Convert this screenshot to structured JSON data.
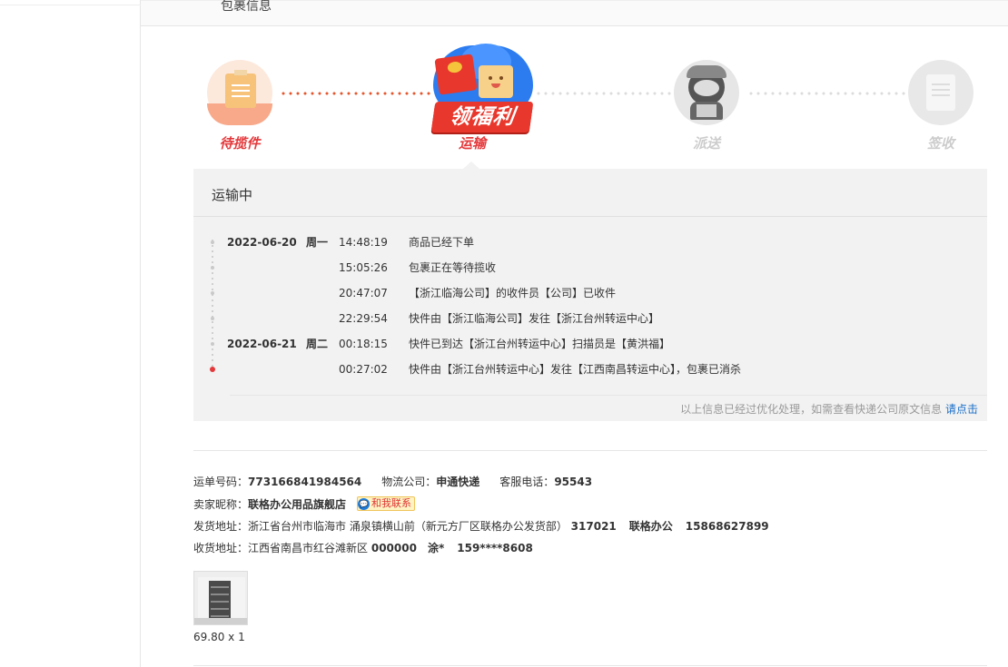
{
  "header": {
    "title": "包裹信息"
  },
  "steps": [
    {
      "label": "待揽件",
      "color": "#e4393c",
      "icon": "package-paper-icon"
    },
    {
      "label": "领福利",
      "color": "#ffffff",
      "icon": "red-packet-promo-icon"
    },
    {
      "label": "运输",
      "color": "#e4393c",
      "icon": ""
    },
    {
      "label": "派送",
      "color": "#cccccc",
      "icon": "courier-icon"
    },
    {
      "label": "签收",
      "color": "#cccccc",
      "icon": "receipt-icon"
    }
  ],
  "tracking": {
    "status": "运输中",
    "events": [
      {
        "date": "2022-06-20",
        "weekday": "周一",
        "time": "14:48:19",
        "desc": "商品已经下单"
      },
      {
        "date": "",
        "weekday": "",
        "time": "15:05:26",
        "desc": "包裹正在等待揽收"
      },
      {
        "date": "",
        "weekday": "",
        "time": "20:47:07",
        "desc": "【浙江临海公司】的收件员【公司】已收件"
      },
      {
        "date": "",
        "weekday": "",
        "time": "22:29:54",
        "desc": "快件由【浙江临海公司】发往【浙江台州转运中心】"
      },
      {
        "date": "2022-06-21",
        "weekday": "周二",
        "time": "00:18:15",
        "desc": "快件已到达【浙江台州转运中心】扫描员是【黄洪福】"
      },
      {
        "date": "",
        "weekday": "",
        "time": "00:27:02",
        "desc": "快件由【浙江台州转运中心】发往【江西南昌转运中心】，包裹已消杀"
      }
    ],
    "note": "以上信息已经过优化处理，如需查看快递公司原文信息",
    "note_link": "请点击"
  },
  "details": {
    "waybill_label": "运单号码：",
    "waybill": "773166841984564",
    "company_label": "物流公司：",
    "company": "申通快递",
    "phone_label": "客服电话：",
    "phone": "95543",
    "seller_label": "卖家昵称：",
    "seller": "联格办公用品旗舰店",
    "chat_label": "和我联系",
    "ship_label": "发货地址：",
    "ship_address": "浙江省台州市临海市 涌泉镇横山前（新元方厂区联格办公发货部）",
    "ship_zip": "317021",
    "ship_name": "联格办公",
    "ship_phone": "15868627899",
    "recv_label": "收货地址：",
    "recv_address": "江西省南昌市红谷滩新区",
    "recv_zip": "000000",
    "recv_name": "涂*",
    "recv_phone": "159****8608"
  },
  "product": {
    "image": "shelf-rack-product-image",
    "qty": "69.80 x 1"
  }
}
